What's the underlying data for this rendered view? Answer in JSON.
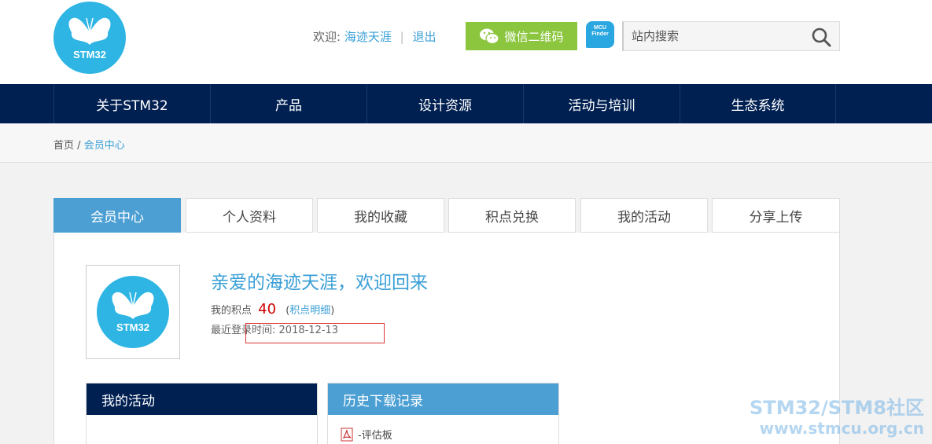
{
  "header": {
    "logo_text": "STM32",
    "welcome_label": "欢迎:",
    "username": "海迹天涯",
    "logout": "退出",
    "wechat_button": "微信二维码",
    "mcu_badge_line1": "MCU",
    "mcu_badge_line2": "Finder",
    "search_placeholder": "站内搜索"
  },
  "nav": {
    "items": [
      "关于STM32",
      "产品",
      "设计资源",
      "活动与培训",
      "生态系统"
    ]
  },
  "breadcrumb": {
    "home": "首页",
    "separator": "/",
    "current": "会员中心"
  },
  "tabs": [
    "会员中心",
    "个人资料",
    "我的收藏",
    "积点兑换",
    "我的活动",
    "分享上传"
  ],
  "profile": {
    "avatar_text": "STM32",
    "greeting": "亲爱的海迹天涯，欢迎回来",
    "points_label": "我的积点",
    "points_value": "40",
    "points_link": "积点明细",
    "login_label": "最近登录时间:",
    "login_date": "2018-12-13"
  },
  "cards": {
    "activity_title": "我的活动",
    "downloads_title": "历史下载记录",
    "downloads": [
      "-评估板"
    ]
  },
  "watermark": {
    "line1": "STM32/STM8社区",
    "line2": "www.stmcu.org.cn"
  },
  "colors": {
    "navy": "#002052",
    "accent_blue": "#4b9fd3",
    "logo_blue": "#2eb5e4",
    "wechat_green": "#8cc63f",
    "points_red": "#cc0000"
  }
}
